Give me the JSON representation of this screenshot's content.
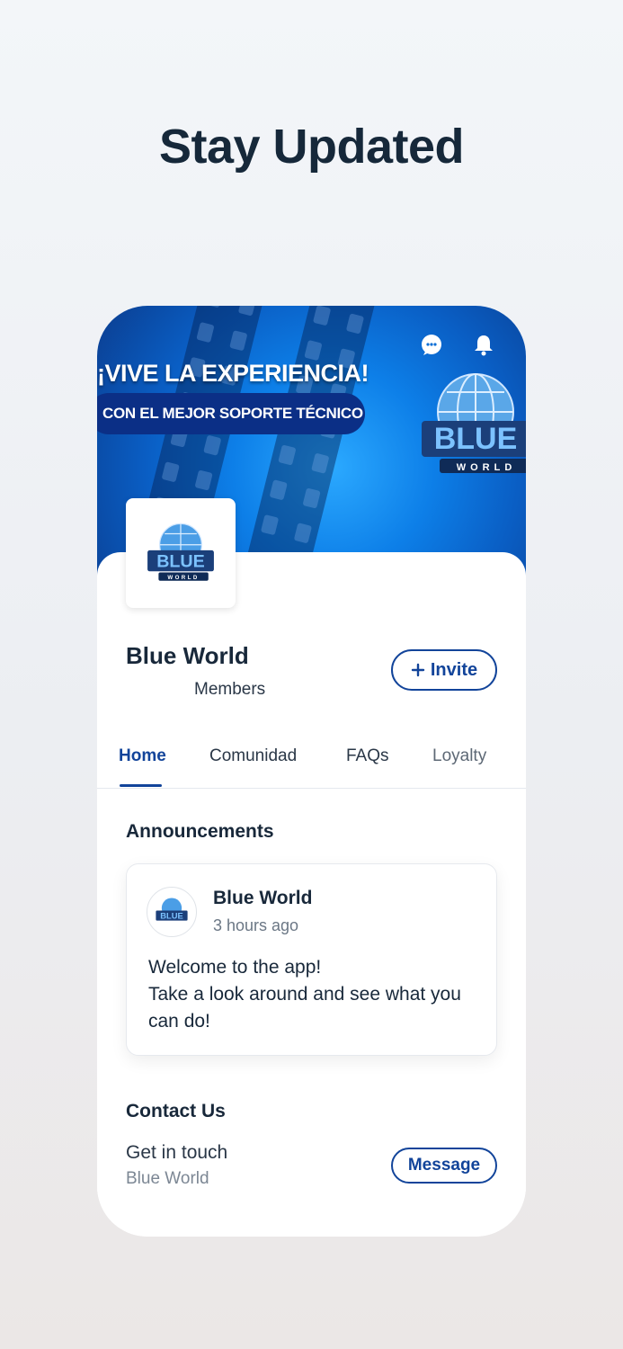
{
  "headline": "Stay Updated",
  "cover": {
    "title": "¡VIVE LA EXPERIENCIA!",
    "subtitle": "CON EL MEJOR SOPORTE TÉCNICO",
    "logo_text": "BLUE",
    "logo_subtext": "WORLD",
    "icons": [
      "chat-icon",
      "bell-icon"
    ]
  },
  "group": {
    "name": "Blue World",
    "members_label": "Members",
    "invite_label": "Invite"
  },
  "tabs": [
    {
      "label": "Home",
      "active": true
    },
    {
      "label": "Comunidad",
      "active": false
    },
    {
      "label": "FAQs",
      "active": false
    },
    {
      "label": "Loyalty",
      "active": false
    }
  ],
  "announcements": {
    "title": "Announcements",
    "post": {
      "author": "Blue World",
      "time": "3 hours ago",
      "line1": "Welcome to the app!",
      "line2": "Take a look around and see what you can do!"
    }
  },
  "contact": {
    "title": "Contact Us",
    "line": "Get in touch",
    "sub": "Blue World",
    "button_label": "Message"
  },
  "colors": {
    "accent": "#12449a",
    "text": "#18283a",
    "cover_blue": "#0d7fe8"
  }
}
